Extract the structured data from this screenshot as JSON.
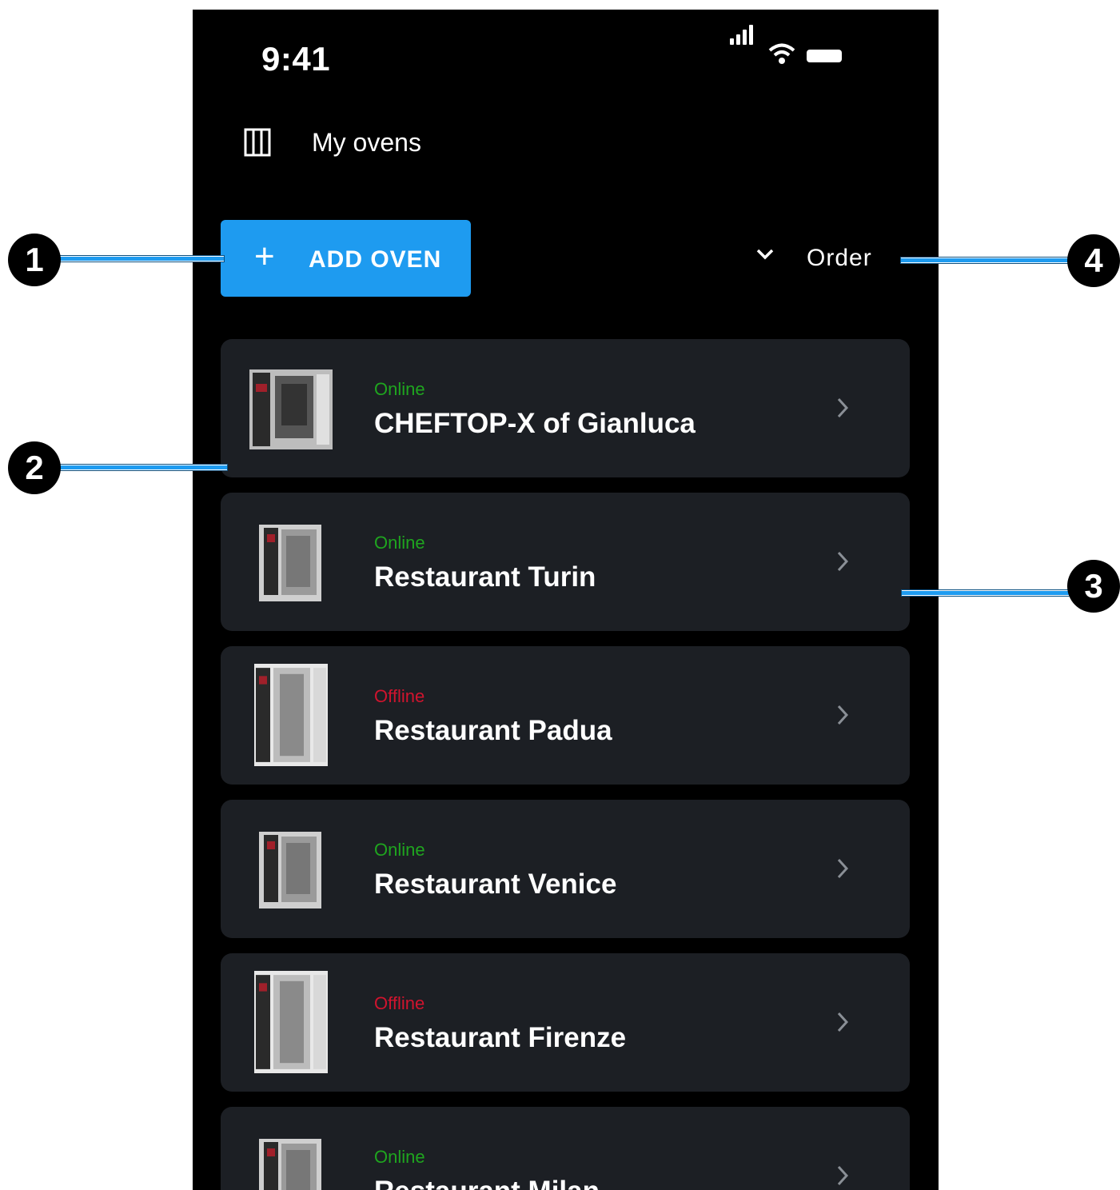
{
  "status_bar": {
    "time": "9:41",
    "icons": [
      "signal-icon",
      "wifi-icon",
      "battery-icon"
    ]
  },
  "header": {
    "icon": "menu-icon",
    "title": "My ovens"
  },
  "toolbar": {
    "add_button_icon": "plus-icon",
    "add_button_label": "ADD OVEN",
    "order_icon": "chevron-down-icon",
    "order_label": "Order"
  },
  "colors": {
    "accent": "#1e9bf0",
    "online": "#1fa51f",
    "offline": "#d0142e",
    "card_bg": "#1c1f24",
    "background": "#000000"
  },
  "ovens": [
    {
      "status": "Online",
      "name": "CHEFTOP-X of Gianluca",
      "thumb": "oven-wide"
    },
    {
      "status": "Online",
      "name": "Restaurant Turin",
      "thumb": "oven-compact"
    },
    {
      "status": "Offline",
      "name": "Restaurant Padua",
      "thumb": "oven-tall"
    },
    {
      "status": "Online",
      "name": "Restaurant Venice",
      "thumb": "oven-compact"
    },
    {
      "status": "Offline",
      "name": "Restaurant Firenze",
      "thumb": "oven-tall"
    },
    {
      "status": "Online",
      "name": "Restaurant Milan",
      "thumb": "oven-compact"
    }
  ],
  "callouts": [
    "1",
    "2",
    "3",
    "4"
  ]
}
